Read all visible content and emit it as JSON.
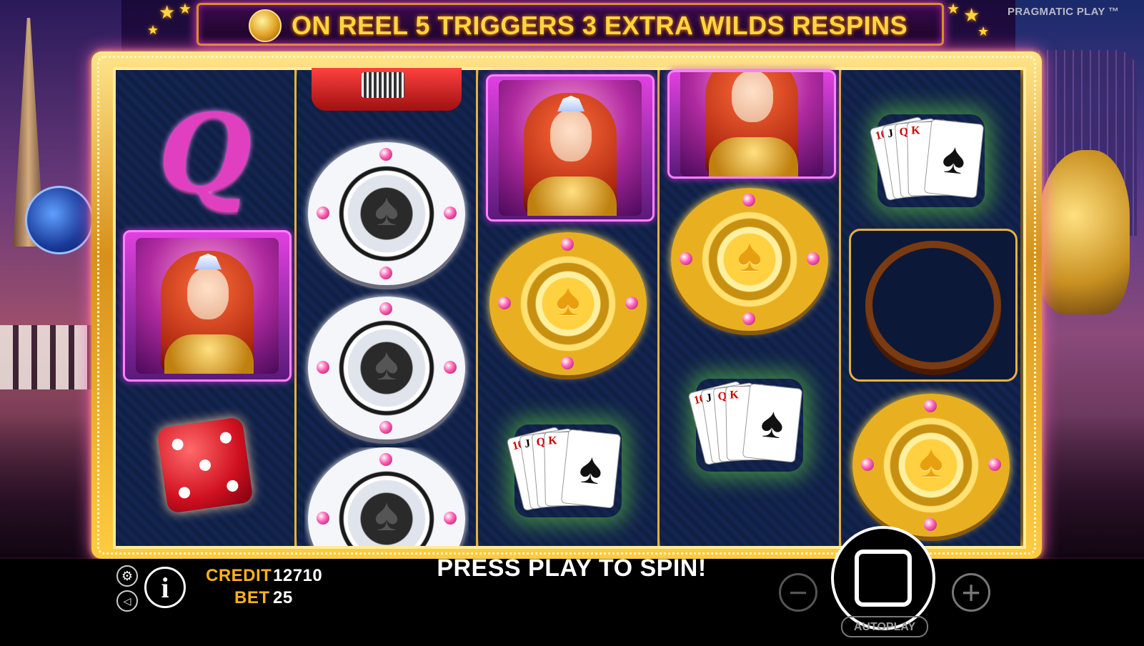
{
  "banner": {
    "text": "ON REEL 5 TRIGGERS 3 EXTRA WILDS RESPINS",
    "coin_icon": "gold-coin-icon"
  },
  "brand": {
    "name": "PRAGMATIC PLAY ™"
  },
  "reels": [
    {
      "symbols": [
        "queen",
        "showgirl",
        "red-dice"
      ]
    },
    {
      "symbols": [
        "red-car",
        "silver-chip",
        "silver-chip",
        "silver-chip"
      ]
    },
    {
      "symbols": [
        "showgirl",
        "gold-chip",
        "royal-flush-cards"
      ]
    },
    {
      "symbols": [
        "showgirl",
        "gold-chip",
        "royal-flush-cards"
      ]
    },
    {
      "symbols": [
        "royal-flush-cards",
        "roulette-wheel",
        "gold-chip"
      ]
    }
  ],
  "symbols_text": {
    "queen_letter": "Q",
    "card_ranks": [
      "10",
      "J",
      "Q",
      "K",
      "A"
    ],
    "ace_suit": "♠",
    "chip_spade": "♠"
  },
  "status": {
    "credit_label": "CREDIT",
    "credit_value": "12710",
    "bet_label": "BET",
    "bet_value": "25",
    "message": "PRESS PLAY TO SPIN!"
  },
  "controls": {
    "settings_icon": "⚙",
    "sound_icon": "◁",
    "info_label": "i",
    "minus_label": "−",
    "plus_label": "+",
    "autoplay_label": "AUTOPLAY"
  },
  "colors": {
    "accent_gold": "#ffd640",
    "label_orange": "#ffb21a",
    "frame_gold": "#d8901a"
  }
}
